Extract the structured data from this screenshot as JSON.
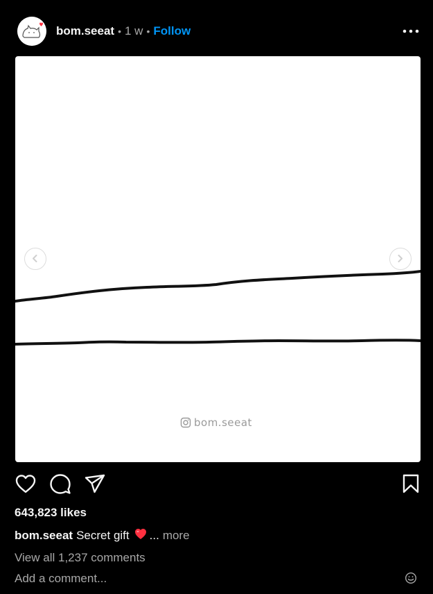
{
  "post": {
    "username": "bom.seeat",
    "separator": "•",
    "time_ago": "1 w",
    "follow_label": "Follow",
    "watermark": "bom.seeat"
  },
  "icons": {
    "more": "more-horizontal-icon",
    "prev": "chevron-left-icon",
    "next": "chevron-right-icon",
    "like": "heart-icon",
    "comment": "comment-icon",
    "share": "share-icon",
    "save": "bookmark-icon",
    "emoji": "emoji-icon",
    "watermark": "instagram-icon"
  },
  "stats": {
    "likes_text": "643,823 likes"
  },
  "caption": {
    "username": "bom.seeat",
    "text": "Secret gift",
    "ellipsis": "...",
    "more_label": "more"
  },
  "comments": {
    "view_all_label": "View all 1,237 comments",
    "add_placeholder": "Add a comment..."
  },
  "colors": {
    "background": "#000000",
    "text": "#f5f5f5",
    "muted": "#a8a8a8",
    "accent": "#0095f6",
    "heart": "#ff3040"
  }
}
